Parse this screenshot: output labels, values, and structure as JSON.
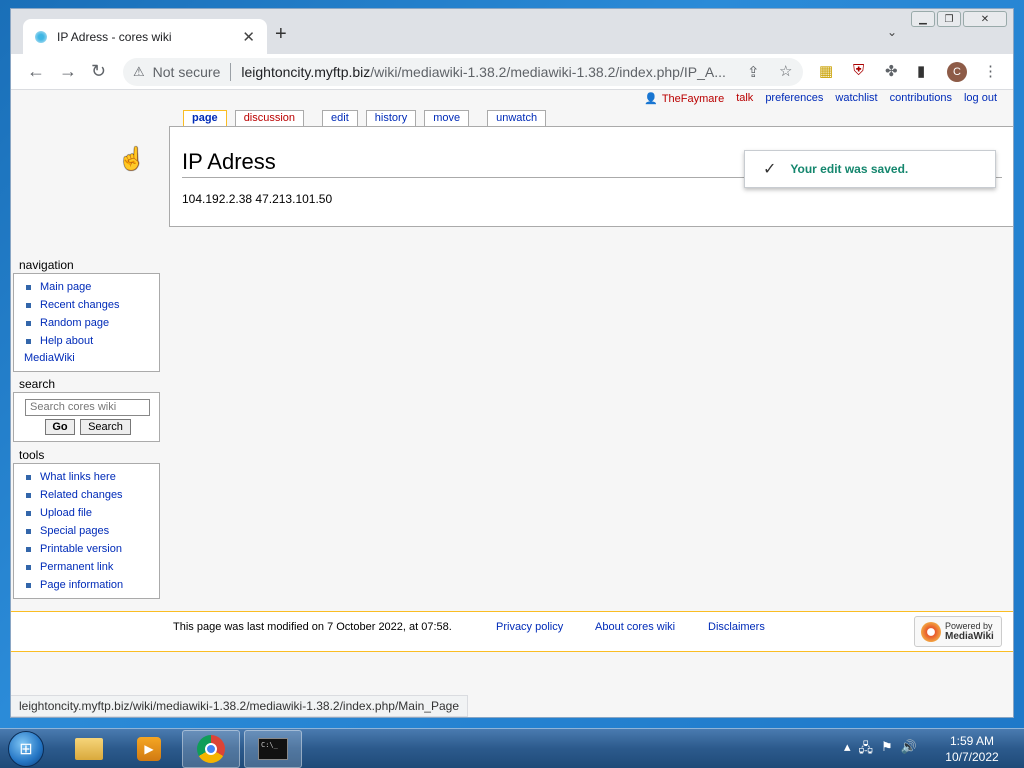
{
  "browser": {
    "tab_title": "IP Adress - cores wiki",
    "tab_close": "✕",
    "new_tab": "+",
    "tab_menu": "⌄",
    "not_secure": "Not secure",
    "url_host": "leightoncity.myftp.biz",
    "url_path": "/wiki/mediawiki-1.38.2/mediawiki-1.38.2/index.php/IP_A...",
    "avatar_letter": "C",
    "status_url": "leightoncity.myftp.biz/wiki/mediawiki-1.38.2/mediawiki-1.38.2/index.php/Main_Page"
  },
  "personal": {
    "username": "TheFaymare",
    "talk": "talk",
    "preferences": "preferences",
    "watchlist": "watchlist",
    "contributions": "contributions",
    "logout": "log out"
  },
  "page_tabs": {
    "page": "page",
    "discussion": "discussion",
    "edit": "edit",
    "history": "history",
    "move": "move",
    "unwatch": "unwatch"
  },
  "content": {
    "heading": "IP Adress",
    "body": "104.192.2.38 47.213.101.50"
  },
  "notification": {
    "message": "Your edit was saved."
  },
  "sidebar": {
    "navigation_title": "navigation",
    "navigation": [
      "Main page",
      "Recent changes",
      "Random page",
      "Help about"
    ],
    "navigation_cont": "MediaWiki",
    "search_title": "search",
    "search_placeholder": "Search cores wiki",
    "go": "Go",
    "search_btn": "Search",
    "tools_title": "tools",
    "tools": [
      "What links here",
      "Related changes",
      "Upload file",
      "Special pages",
      "Printable version",
      "Permanent link",
      "Page information"
    ]
  },
  "footer": {
    "last_modified": "This page was last modified on 7 October 2022, at 07:58.",
    "privacy": "Privacy policy",
    "about": "About cores wiki",
    "disclaimers": "Disclaimers",
    "powered_by": "Powered by",
    "mediawiki": "MediaWiki"
  },
  "taskbar": {
    "time": "1:59 AM",
    "date": "10/7/2022"
  }
}
